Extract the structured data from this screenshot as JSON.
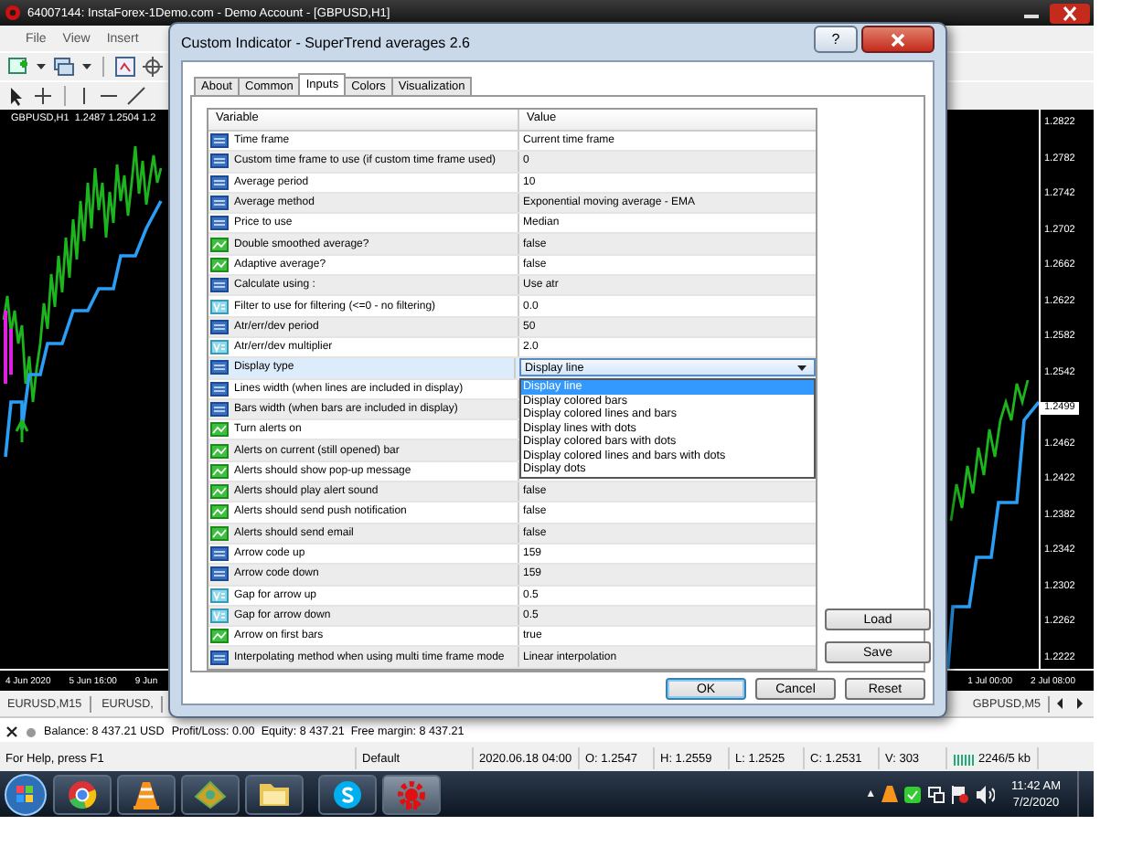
{
  "window": {
    "title": "64007144: InstaForex-1Demo.com - Demo Account - [GBPUSD,H1]"
  },
  "menu": [
    "File",
    "View",
    "Insert"
  ],
  "chart": {
    "header": "GBPUSD,H1  1.2487 1.2504 1.2",
    "price_labels": [
      {
        "label": "1.2822",
        "current": false
      },
      {
        "label": "1.2782",
        "current": false
      },
      {
        "label": "1.2742",
        "current": false
      },
      {
        "label": "1.2702",
        "current": false
      },
      {
        "label": "1.2662",
        "current": false
      },
      {
        "label": "1.2622",
        "current": false
      },
      {
        "label": "1.2582",
        "current": false
      },
      {
        "label": "1.2542",
        "current": false
      },
      {
        "label": "1.2499",
        "current": true
      },
      {
        "label": "1.2462",
        "current": false
      },
      {
        "label": "1.2422",
        "current": false
      },
      {
        "label": "1.2382",
        "current": false
      },
      {
        "label": "1.2342",
        "current": false
      },
      {
        "label": "1.2302",
        "current": false
      },
      {
        "label": "1.2262",
        "current": false
      },
      {
        "label": "1.2222",
        "current": false
      }
    ],
    "time_labels_left": [
      "4 Jun 2020",
      "5 Jun 16:00",
      "9 Jun"
    ],
    "time_labels_right": [
      "1 Jul 00:00",
      "2 Jul 08:00"
    ]
  },
  "chart_tabs": [
    "EURUSD,M15",
    "EURUSD,",
    "GBPUSD,M5"
  ],
  "terminal": {
    "balance": "Balance: 8 437.21 USD",
    "summary": "Profit/Loss: 0.00  Equity: 8 437.21  Free margin: 8 437.21"
  },
  "status_bar": [
    "For Help, press F1",
    "Default",
    "2020.06.18 04:00",
    "O: 1.2547",
    "H: 1.2559",
    "L: 1.2525",
    "C: 1.2531",
    "V: 303",
    "2246/5 kb"
  ],
  "taskbar": {
    "tray_arrow": "▲",
    "clock_time": "11:42 AM",
    "clock_date": "7/2/2020"
  },
  "dialog": {
    "title": "Custom Indicator - SuperTrend averages 2.6",
    "help_button": "?",
    "tabs": [
      {
        "label": "About",
        "selected": false
      },
      {
        "label": "Common",
        "selected": false
      },
      {
        "label": "Inputs",
        "selected": true
      },
      {
        "label": "Colors",
        "selected": false
      },
      {
        "label": "Visualization",
        "selected": false
      }
    ],
    "columns": [
      "Variable",
      "Value"
    ],
    "rows": [
      {
        "kind": "int",
        "name": "Time frame",
        "value": "Current time frame",
        "selected": false
      },
      {
        "kind": "int",
        "name": "Custom time frame to use (if custom time frame used)",
        "value": "0",
        "selected": false
      },
      {
        "kind": "int",
        "name": "Average period",
        "value": "10",
        "selected": false
      },
      {
        "kind": "int",
        "name": "Average method",
        "value": "Exponential moving average - EMA",
        "selected": false
      },
      {
        "kind": "int",
        "name": "Price to use",
        "value": "Median",
        "selected": false
      },
      {
        "kind": "bool",
        "name": "Double smoothed average?",
        "value": "false",
        "selected": false
      },
      {
        "kind": "bool",
        "name": "Adaptive average?",
        "value": "false",
        "selected": false
      },
      {
        "kind": "int",
        "name": "Calculate using :",
        "value": "Use atr",
        "selected": false
      },
      {
        "kind": "double",
        "name": "Filter to use for filtering (<=0 - no filtering)",
        "value": "0.0",
        "selected": false
      },
      {
        "kind": "int",
        "name": "Atr/err/dev period",
        "value": "50",
        "selected": false
      },
      {
        "kind": "double",
        "name": "Atr/err/dev multiplier",
        "value": "2.0",
        "selected": false
      },
      {
        "kind": "int",
        "name": "Display type",
        "value": "Display line",
        "selected": true,
        "options": [
          {
            "label": "Display line",
            "selected": true
          },
          {
            "label": "Display colored bars",
            "selected": false
          },
          {
            "label": "Display colored lines and bars",
            "selected": false
          },
          {
            "label": "Display lines with dots",
            "selected": false
          },
          {
            "label": "Display colored bars with dots",
            "selected": false
          },
          {
            "label": "Display colored lines and bars with dots",
            "selected": false
          },
          {
            "label": "Display dots",
            "selected": false
          }
        ]
      },
      {
        "kind": "int",
        "name": "Lines width (when lines are included in display)",
        "selected": false
      },
      {
        "kind": "int",
        "name": "Bars width (when bars are included in display)",
        "selected": false
      },
      {
        "kind": "bool",
        "name": "Turn alerts on",
        "selected": false
      },
      {
        "kind": "bool",
        "name": "Alerts on current (still opened) bar",
        "selected": false
      },
      {
        "kind": "bool",
        "name": "Alerts should show pop-up message",
        "selected": false
      },
      {
        "kind": "bool",
        "name": "Alerts should play alert sound",
        "value": "false",
        "selected": false
      },
      {
        "kind": "bool",
        "name": "Alerts should send push notification",
        "value": "false",
        "selected": false
      },
      {
        "kind": "bool",
        "name": "Alerts should send email",
        "value": "false",
        "selected": false
      },
      {
        "kind": "int",
        "name": "Arrow code up",
        "value": "159",
        "selected": false
      },
      {
        "kind": "int",
        "name": "Arrow code down",
        "value": "159",
        "selected": false
      },
      {
        "kind": "double",
        "name": "Gap for arrow up",
        "value": "0.5",
        "selected": false
      },
      {
        "kind": "double",
        "name": "Gap for arrow down",
        "value": "0.5",
        "selected": false
      },
      {
        "kind": "bool",
        "name": "Arrow on first bars",
        "value": "true",
        "selected": false
      },
      {
        "kind": "int",
        "name": "Interpolating method when using multi time frame mode",
        "value": "Linear interpolation",
        "selected": false
      }
    ],
    "side_buttons": [
      "Load",
      "Save"
    ],
    "buttons": [
      {
        "label": "OK",
        "default": true
      },
      {
        "label": "Cancel",
        "default": false
      },
      {
        "label": "Reset",
        "default": false
      }
    ]
  }
}
